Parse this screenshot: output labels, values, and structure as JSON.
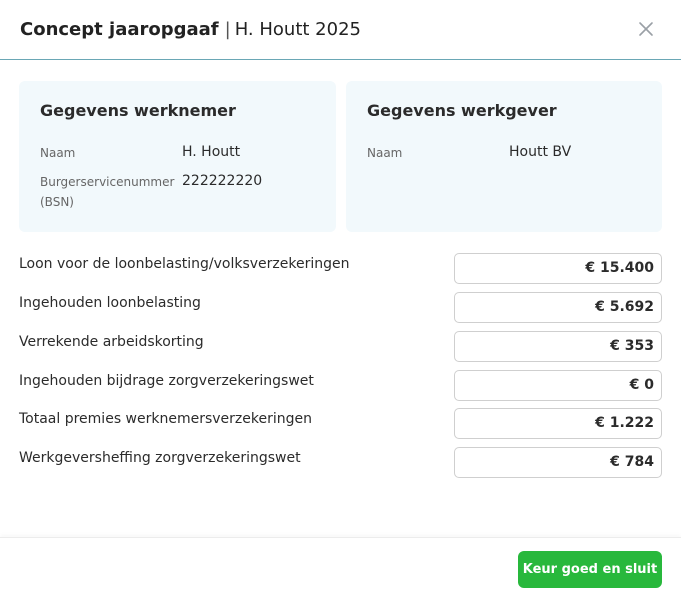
{
  "header": {
    "title_bold": "Concept jaaropgaaf",
    "separator": "|",
    "title_rest": "H. Houtt 2025",
    "close_icon": "close-icon"
  },
  "employee": {
    "heading": "Gegevens werknemer",
    "name_label": "Naam",
    "name_value": "H. Houtt",
    "bsn_label_line1": "Burgerservicenummer",
    "bsn_label_line2": "(BSN)",
    "bsn_value": "222222220"
  },
  "employer": {
    "heading": "Gegevens werkgever",
    "name_label": "Naam",
    "name_value": "Houtt BV"
  },
  "rows": [
    {
      "label": "Loon voor de loonbelasting/volksverzekeringen",
      "amount": "€ 15.400"
    },
    {
      "label": "Ingehouden loonbelasting",
      "amount": "€ 5.692"
    },
    {
      "label": "Verrekende arbeidskorting",
      "amount": "€ 353"
    },
    {
      "label": "Ingehouden bijdrage zorgverzekeringswet",
      "amount": "€ 0"
    },
    {
      "label": "Totaal premies werknemersverzekeringen",
      "amount": "€ 1.222"
    },
    {
      "label": "Werkgeversheffing zorgverzekeringswet",
      "amount": "€ 784"
    }
  ],
  "footer": {
    "approve_label": "Keur goed en sluit"
  },
  "colors": {
    "accent_green": "#28b83c",
    "card_background": "#f2f9fc",
    "header_border": "#6aa7b5"
  }
}
